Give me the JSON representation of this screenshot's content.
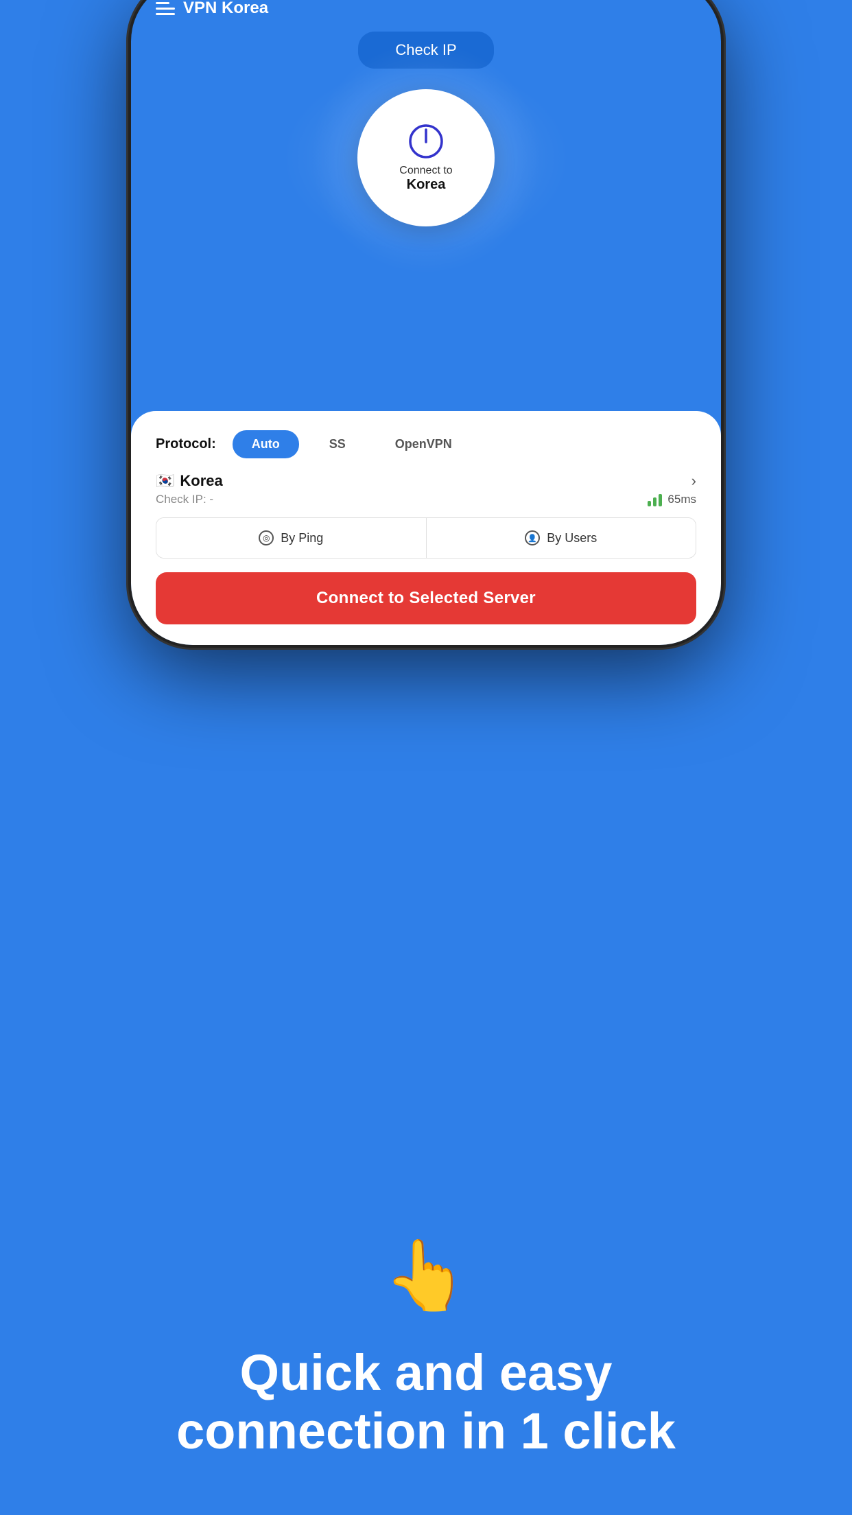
{
  "app": {
    "title": "VPN Korea",
    "background_color": "#2f7fe8"
  },
  "header": {
    "title": "VPN Korea",
    "menu_icon": "hamburger-icon"
  },
  "check_ip_button": {
    "label": "Check IP"
  },
  "power_button": {
    "connect_label": "Connect to",
    "country": "Korea"
  },
  "protocol": {
    "label": "Protocol:",
    "options": [
      "Auto",
      "SS",
      "OpenVPN"
    ],
    "active": "Auto"
  },
  "server": {
    "flag": "🇰🇷",
    "name": "Korea",
    "check_ip_label": "Check IP: -",
    "ping": "65ms"
  },
  "sort_buttons": {
    "by_ping": "By Ping",
    "by_users": "By Users"
  },
  "connect_button": {
    "label": "Connect to Selected Server"
  },
  "tagline": {
    "emoji": "👆",
    "text": "Quick and easy connection in 1 click"
  }
}
